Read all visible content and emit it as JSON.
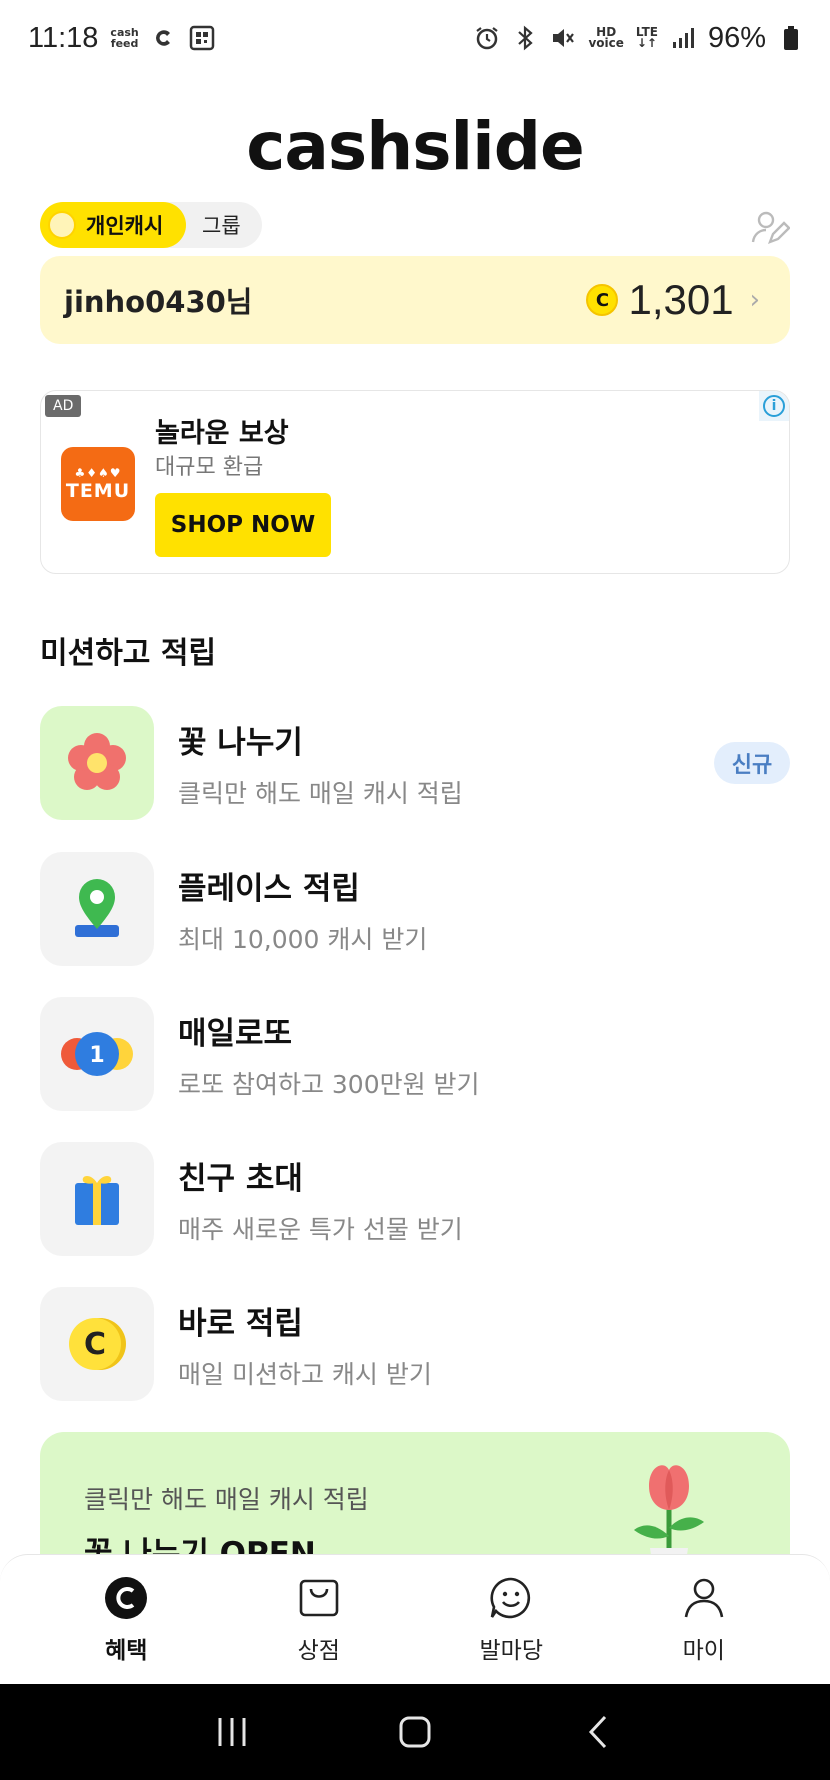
{
  "status_bar": {
    "time": "11:18",
    "cashfeed_line1": "cash",
    "cashfeed_line2": "feed",
    "hd_line1": "HD",
    "hd_line2": "voice",
    "lte_line1": "LTE",
    "lte_line2": "↓↑",
    "battery": "96%"
  },
  "app": {
    "logo": "cashslide"
  },
  "toggle": {
    "active": "개인캐시",
    "other": "그룹"
  },
  "balance": {
    "username": "jinho0430님",
    "coin_symbol": "C",
    "amount": "1,301",
    "chevron": "›"
  },
  "ad": {
    "badge": "AD",
    "info": "i",
    "brand": "TEMU",
    "brand_icons": "♣♦♠♥",
    "title": "놀라운 보상",
    "subtitle": "대규모 환급",
    "cta": "SHOP NOW"
  },
  "missions": {
    "section_title": "미션하고 적립",
    "items": [
      {
        "title": "꽃 나누기",
        "desc": "클릭만 해도 매일 캐시 적립",
        "badge": "신규"
      },
      {
        "title": "플레이스 적립",
        "desc": "최대 10,000 캐시 받기"
      },
      {
        "title": "매일로또",
        "desc": "로또 참여하고 300만원 받기",
        "icon_num": "1"
      },
      {
        "title": "친구 초대",
        "desc": "매주 새로운 특가 선물 받기"
      },
      {
        "title": "바로 적립",
        "desc": "매일 미션하고 캐시 받기",
        "icon_letter": "C"
      }
    ]
  },
  "banner": {
    "subtitle": "클릭만 해도 매일 캐시 적립",
    "title": "꽃 나누기 OPEN"
  },
  "bottom_nav": [
    {
      "label": "혜택",
      "icon": "benefit-icon",
      "active": true
    },
    {
      "label": "상점",
      "icon": "shop-bag-icon"
    },
    {
      "label": "발마당",
      "icon": "chat-smile-icon"
    },
    {
      "label": "마이",
      "icon": "person-icon"
    }
  ],
  "colors": {
    "accent_yellow": "#ffe100",
    "balance_bg": "#fff8cc",
    "green_bg": "#dcf8c8",
    "temu_orange": "#f46b14"
  }
}
